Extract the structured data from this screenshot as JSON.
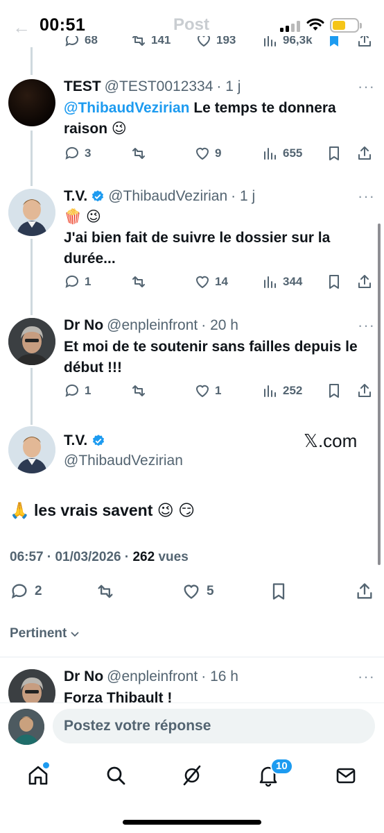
{
  "status_bar": {
    "time": "00:51",
    "back_ghost": "←",
    "title_ghost": "Post"
  },
  "top_partial_actions": {
    "replies": "68",
    "reposts": "141",
    "likes": "193",
    "views": "96,3k"
  },
  "tweets": [
    {
      "name": "TEST",
      "handle": "@TEST0012334",
      "time": "· 1 j",
      "mention": "@ThibaudVezirian",
      "text": " Le temps te donnera raison 😉",
      "replies": "3",
      "reposts": "",
      "likes": "9",
      "views": "655"
    },
    {
      "name": "T.V.",
      "handle": "@ThibaudVezirian",
      "time": "· 1 j",
      "emoji_line": "🍿 😉",
      "text": "J'ai bien fait de suivre le dossier sur la durée...",
      "replies": "1",
      "reposts": "",
      "likes": "14",
      "views": "344"
    },
    {
      "name": "Dr No",
      "handle": "@enpleinfront",
      "time": "· 20 h",
      "text": "Et moi de te soutenir sans failles depuis le début !!!",
      "replies": "1",
      "reposts": "",
      "likes": "1",
      "views": "252"
    }
  ],
  "main_tweet": {
    "name": "T.V.",
    "handle": "@ThibaudVezirian",
    "source_label": "𝕏.com",
    "text": "🙏 les vrais savent 😉 😏",
    "datetime": "06:57 · 01/03/2026 · ",
    "views_count": "262",
    "views_label": " vues",
    "replies": "2",
    "likes": "5"
  },
  "sort_label": "Pertinent",
  "next_reply": {
    "name": "Dr No",
    "handle": "@enpleinfront",
    "time": "· 16 h",
    "text": "Forza Thibault !"
  },
  "reply_bar": {
    "placeholder": "Postez votre réponse"
  },
  "nav": {
    "notifications_badge": "10"
  },
  "more_glyph": "···",
  "colors": {
    "accent": "#1d9bf0",
    "muted": "#536471",
    "text": "#0f1419",
    "line": "#cfd9de"
  }
}
